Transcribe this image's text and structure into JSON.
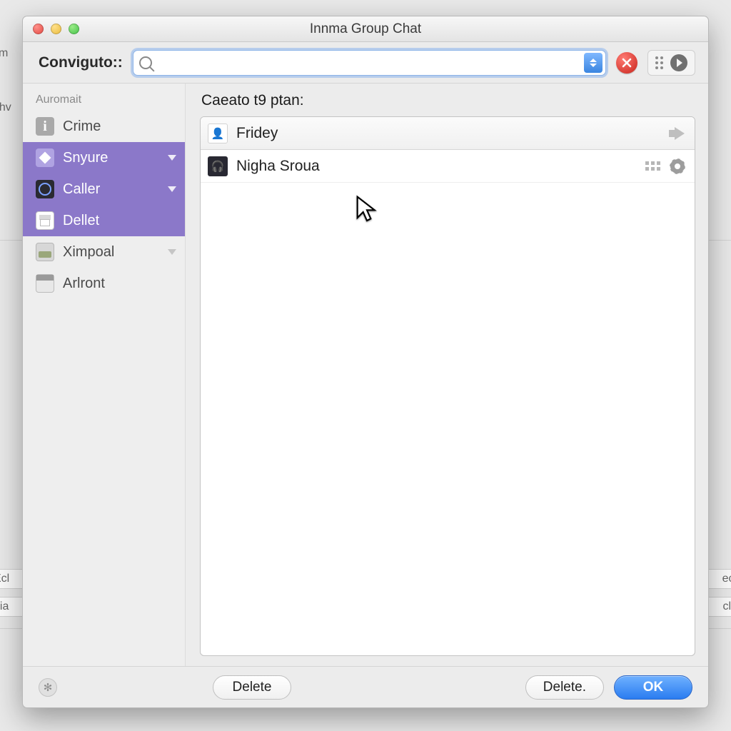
{
  "background": {
    "left_text_top": "cm",
    "left_text_mid": "ehv",
    "left_stub1": "Ecl",
    "left_stub2": "dia",
    "right_stub1": "ect",
    "right_stub2": "cle"
  },
  "title": "Innma Group Chat",
  "toolbar": {
    "label": "Conviguto::",
    "search_value": "",
    "search_placeholder": ""
  },
  "sidebar": {
    "section": "Auromait",
    "items": [
      {
        "label": "Crime",
        "selected": false,
        "chevron": false,
        "icon": "info"
      },
      {
        "label": "Snyure",
        "selected": true,
        "chevron": true,
        "icon": "diamond"
      },
      {
        "label": "Caller",
        "selected": true,
        "chevron": true,
        "icon": "target"
      },
      {
        "label": "Dellet",
        "selected": true,
        "chevron": false,
        "icon": "print"
      },
      {
        "label": "Ximpoal",
        "selected": false,
        "chevron": true,
        "icon": "tray"
      },
      {
        "label": "Arlront",
        "selected": false,
        "chevron": false,
        "icon": "cal"
      }
    ]
  },
  "content": {
    "heading": "Caeato t9 ptan:",
    "rows": [
      {
        "name": "Fridey",
        "thumb": "light",
        "right": "arrow"
      },
      {
        "name": "Nigha Sroua",
        "thumb": "dark",
        "right": "gear"
      }
    ]
  },
  "footer": {
    "delete_left": "Delete",
    "delete_right": "Delete.",
    "ok": "OK"
  }
}
